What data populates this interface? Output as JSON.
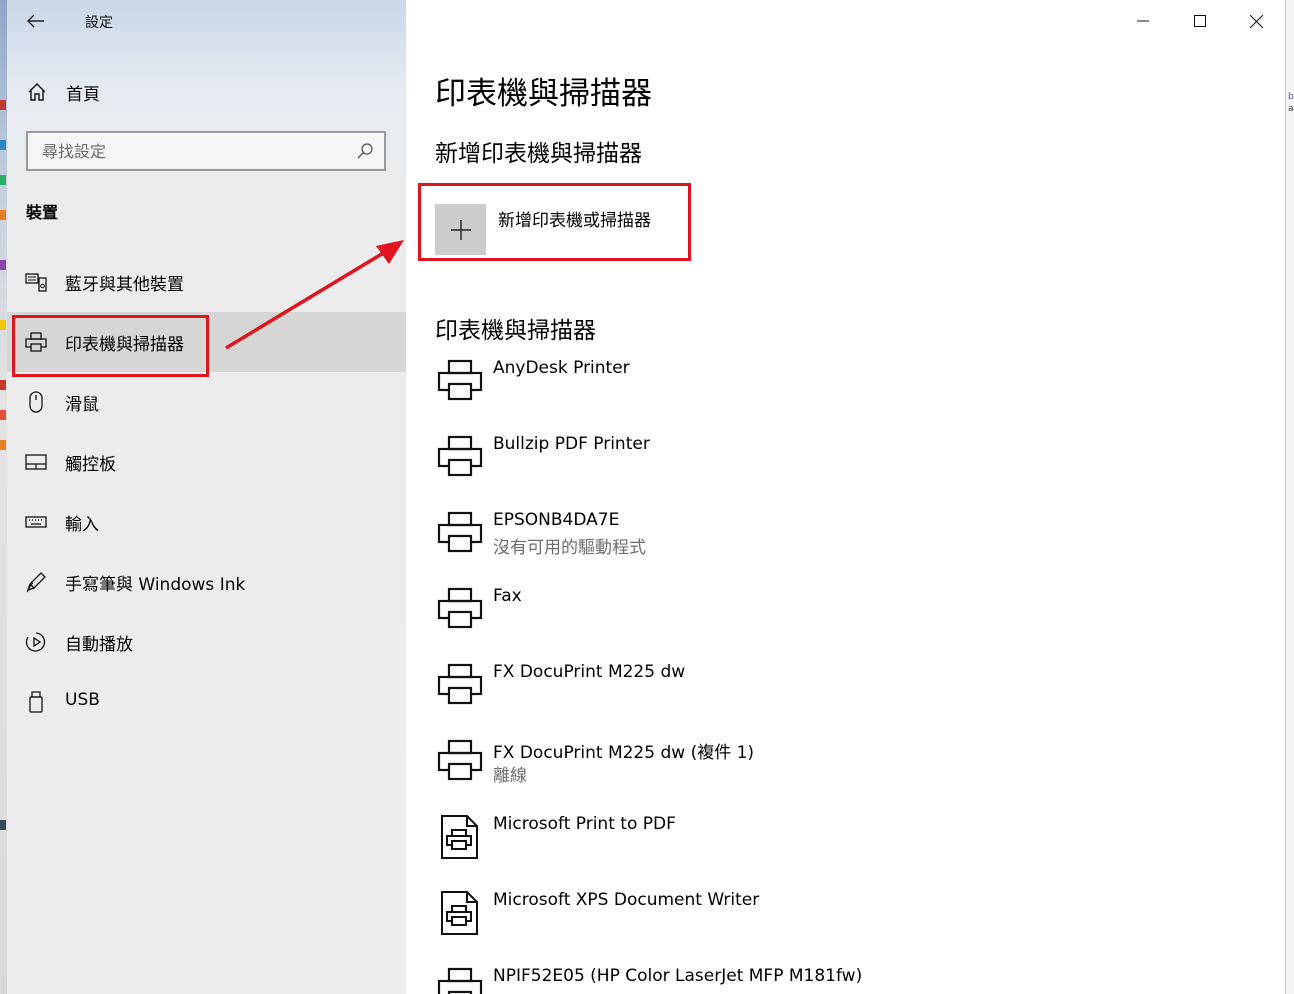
{
  "app": {
    "title": "設定"
  },
  "sidebar": {
    "home_label": "首頁",
    "search_placeholder": "尋找設定",
    "section_label": "裝置",
    "items": [
      {
        "label": "藍牙與其他裝置",
        "icon": "bluetooth-devices-icon"
      },
      {
        "label": "印表機與掃描器",
        "icon": "printer-icon",
        "selected": true
      },
      {
        "label": "滑鼠",
        "icon": "mouse-icon"
      },
      {
        "label": "觸控板",
        "icon": "touchpad-icon"
      },
      {
        "label": "輸入",
        "icon": "keyboard-icon"
      },
      {
        "label": "手寫筆與 Windows Ink",
        "icon": "pen-icon"
      },
      {
        "label": "自動播放",
        "icon": "autoplay-icon"
      },
      {
        "label": "USB",
        "icon": "usb-icon"
      }
    ]
  },
  "main": {
    "title": "印表機與掃描器",
    "add_section_title": "新增印表機與掃描器",
    "add_button_label": "新增印表機或掃描器",
    "list_section_title": "印表機與掃描器",
    "printers": [
      {
        "name": "AnyDesk Printer",
        "status": "",
        "icon": "printer-icon"
      },
      {
        "name": "Bullzip PDF Printer",
        "status": "",
        "icon": "printer-icon"
      },
      {
        "name": "EPSONB4DA7E",
        "status": "沒有可用的驅動程式",
        "icon": "printer-icon"
      },
      {
        "name": "Fax",
        "status": "",
        "icon": "printer-icon"
      },
      {
        "name": "FX DocuPrint M225 dw",
        "status": "",
        "icon": "printer-icon"
      },
      {
        "name": "FX DocuPrint M225 dw (複件 1)",
        "status": "離線",
        "icon": "printer-icon"
      },
      {
        "name": "Microsoft Print to PDF",
        "status": "",
        "icon": "document-printer-icon"
      },
      {
        "name": "Microsoft XPS Document Writer",
        "status": "",
        "icon": "document-printer-icon"
      },
      {
        "name": "NPIF52E05 (HP Color LaserJet MFP M181fw)",
        "status": "",
        "icon": "printer-icon"
      }
    ]
  },
  "colors": {
    "annotation_red": "#e0141e",
    "selected_bg": "#d6d6d6",
    "add_tile_bg": "#cccccc"
  }
}
